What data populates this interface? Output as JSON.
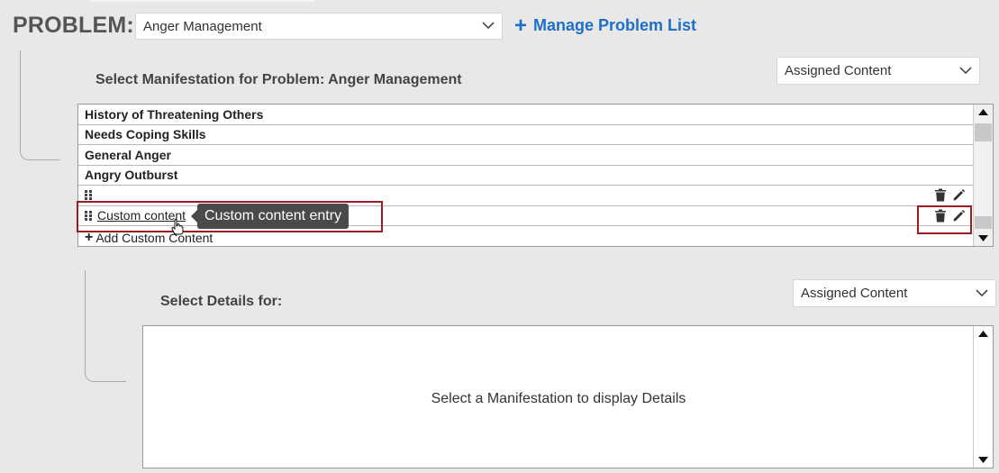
{
  "problem": {
    "label": "PROBLEM:",
    "selected": "Anger Management"
  },
  "manage_link": {
    "label": "Manage Problem List"
  },
  "manifestation": {
    "title": "Select Manifestation for Problem: Anger Management",
    "filter": "Assigned Content",
    "items": [
      {
        "label": "History of Threatening Others"
      },
      {
        "label": "Needs Coping Skills"
      },
      {
        "label": "General Anger"
      },
      {
        "label": "Angry Outburst"
      },
      {
        "label": ""
      },
      {
        "label": "Custom content"
      }
    ],
    "add_label": "Add Custom Content",
    "tooltip": "Custom content entry"
  },
  "details": {
    "title": "Select Details for:",
    "filter": "Assigned Content",
    "empty_message": "Select a Manifestation to display Details"
  },
  "colors": {
    "link_blue": "#1f6fc6",
    "highlight_red": "#9b1d21",
    "tooltip_bg": "#4a4a4a"
  },
  "icons": {
    "drag": "drag-handle-icon",
    "delete": "trash-icon",
    "edit": "pencil-icon",
    "add": "plus-icon",
    "dropdown": "chevron-down-icon"
  }
}
